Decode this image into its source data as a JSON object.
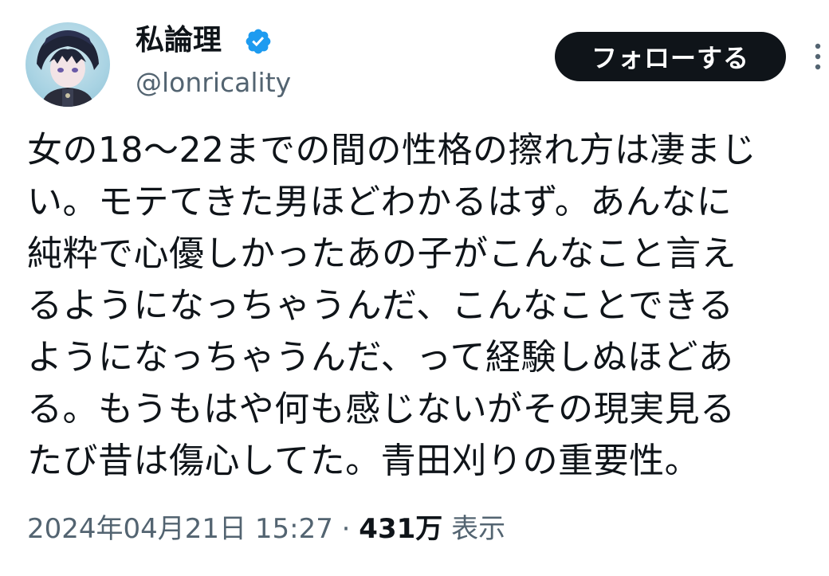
{
  "author": {
    "display_name": "私論理",
    "handle": "@lonricality",
    "verified": true,
    "verified_color": "#1d9bf0"
  },
  "actions": {
    "follow_label": "フォローする",
    "more_icon": "more-vertical-icon"
  },
  "tweet": {
    "lines": [
      "女の18〜22までの間の性格の擦れ方は凄まじ",
      "い。モテてきた男ほどわかるはず。あんなに",
      "純粋で心優しかったあの子がこんなこと言え",
      "るようになっちゃうんだ、こんなことできる",
      "ようになっちゃうんだ、って経験しぬほどあ",
      "る。もうもはや何も感じないがその現実見る",
      "たび昔は傷心してた。青田刈りの重要性。"
    ]
  },
  "meta": {
    "timestamp": "2024年04月21日 15:27",
    "separator": "·",
    "views_count": "431万",
    "views_label": "表示"
  }
}
